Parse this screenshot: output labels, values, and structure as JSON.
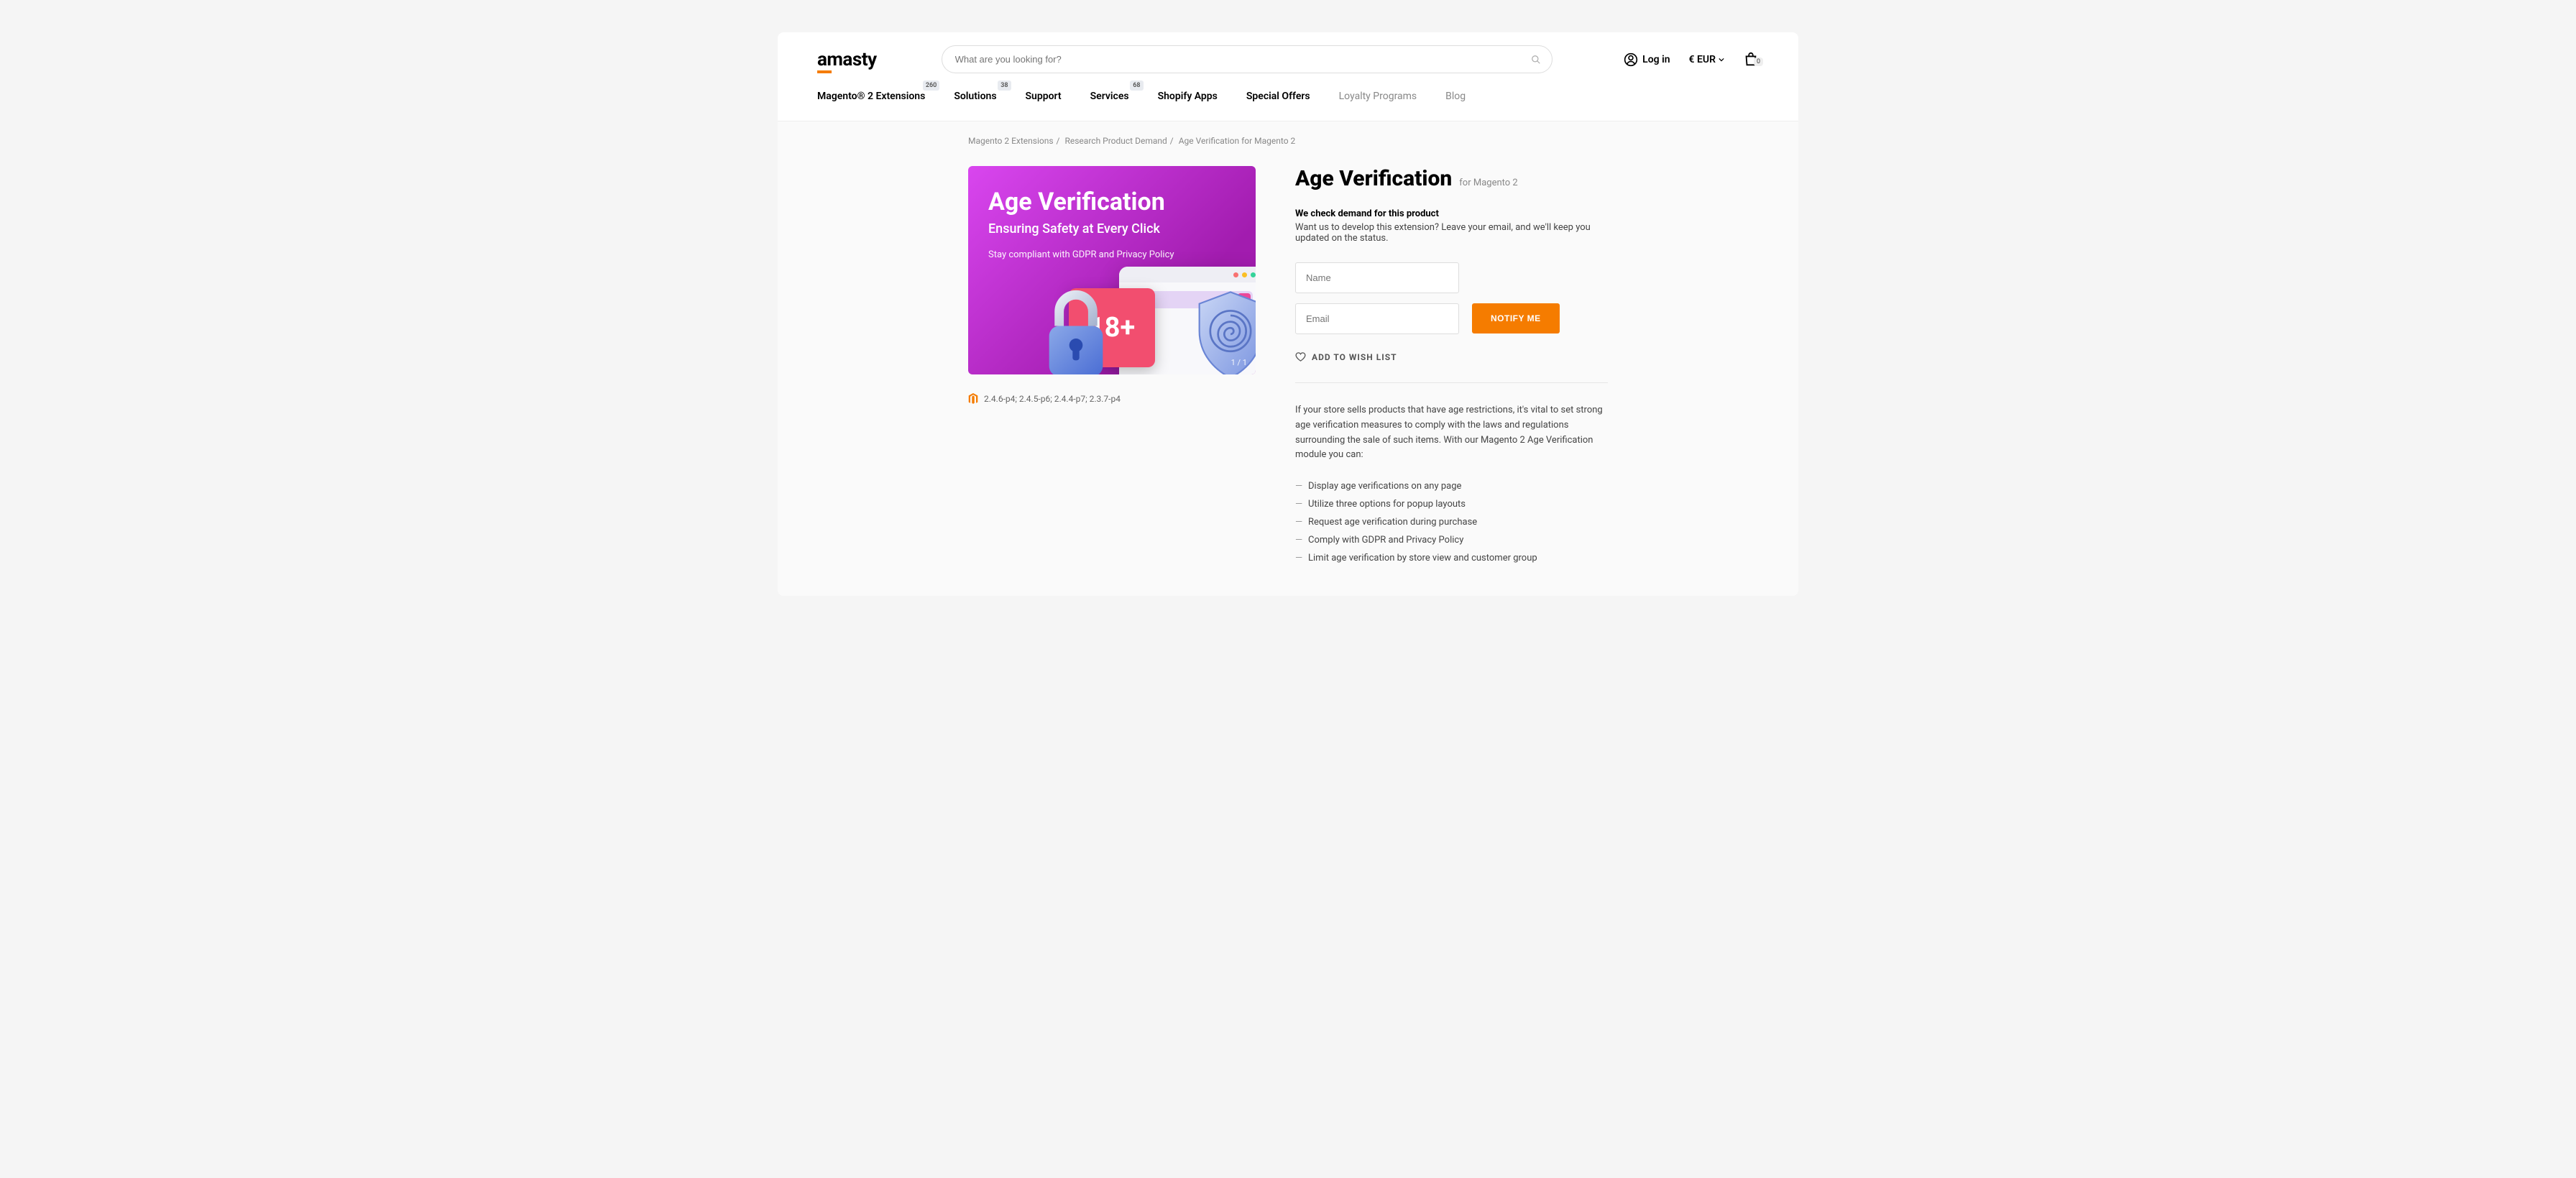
{
  "header": {
    "logo": "amasty",
    "search_placeholder": "What are you looking for?",
    "login": "Log in",
    "currency": "€ EUR",
    "cart_count": "0"
  },
  "nav": [
    {
      "label": "Magento® 2 Extensions",
      "badge": "260"
    },
    {
      "label": "Solutions",
      "badge": "38"
    },
    {
      "label": "Support"
    },
    {
      "label": "Services",
      "badge": "68"
    },
    {
      "label": "Shopify Apps"
    },
    {
      "label": "Special Offers"
    },
    {
      "label": "Loyalty Programs",
      "muted": true
    },
    {
      "label": "Blog",
      "muted": true
    }
  ],
  "breadcrumb": {
    "a": "Magento 2 Extensions",
    "b": "Research Product Demand",
    "c": "Age Verification for Magento 2"
  },
  "hero": {
    "title": "Age Verification",
    "subtitle": "Ensuring Safety at Every Click",
    "tagline": "Stay compliant with GDPR and Privacy Policy",
    "badge": "18+",
    "counter": "1 / 1"
  },
  "compat": "2.4.6-p4; 2.4.5-p6; 2.4.4-p7; 2.3.7-p4",
  "product": {
    "title": "Age Verification",
    "platform": "for Magento 2",
    "demand_title": "We check demand for this product",
    "demand_text": "Want us to develop this extension? Leave your email, and we'll keep you updated on the status.",
    "name_ph": "Name",
    "email_ph": "Email",
    "notify": "NOTIFY ME",
    "wishlist": "ADD TO WISH LIST",
    "desc": "If your store sells products that have age restrictions, it's vital to set strong age verification measures to comply with the laws and regulations surrounding the sale of such items. With our Magento 2 Age Verification module you can:",
    "features": [
      "Display age verifications on any page",
      "Utilize three options for popup layouts",
      "Request age verification during purchase",
      "Comply with GDPR and Privacy Policy",
      "Limit age verification by store view and customer group"
    ]
  }
}
